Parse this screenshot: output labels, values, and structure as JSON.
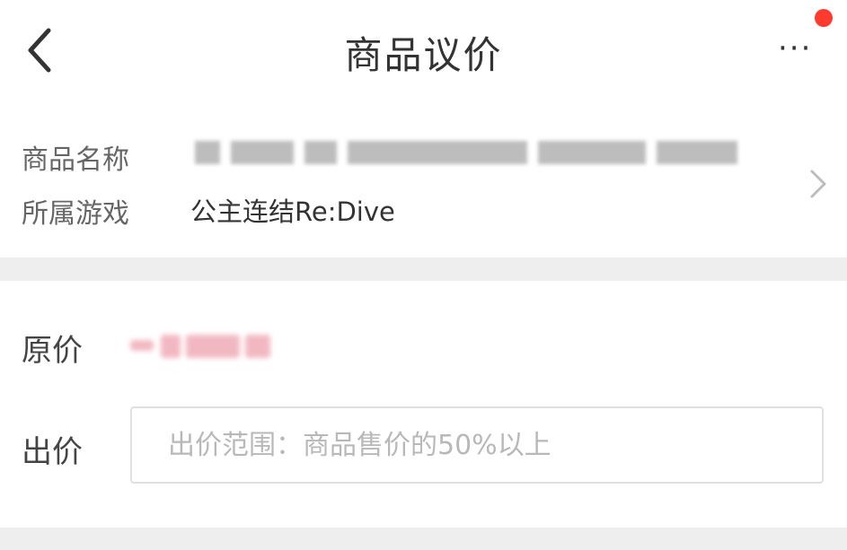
{
  "header": {
    "title": "商品议价",
    "back_icon": "chevron-left-icon",
    "more_icon": "more-horizontal-icon",
    "more_glyph": "···",
    "notification_dot_color": "#ff3b30"
  },
  "product": {
    "name_label": "商品名称",
    "game_label": "所属游戏",
    "game_value": "公主连结Re:Dive",
    "arrow_icon": "chevron-right-icon"
  },
  "pricing": {
    "original_label": "原价",
    "offer_label": "出价",
    "offer_placeholder": "出价范围：商品售价的50%以上",
    "offer_value": ""
  },
  "colors": {
    "divider": "#eeeeee",
    "price_accent": "#f2b8c2"
  }
}
